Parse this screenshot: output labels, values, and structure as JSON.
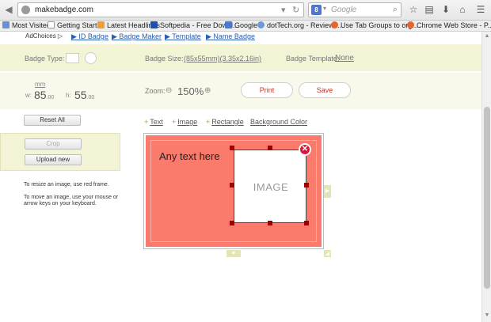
{
  "browser": {
    "url": "makebadge.com",
    "search_placeholder": "Google",
    "search_engine_letter": "8"
  },
  "bookmarks": [
    {
      "label": "Most Visited",
      "color": "#6b8fd6"
    },
    {
      "label": "Getting Started",
      "color": "#ffffff"
    },
    {
      "label": "Latest Headlines",
      "color": "#f0a030"
    },
    {
      "label": "Softpedia - Free Downl...",
      "color": "#1f4fa8"
    },
    {
      "label": "Google",
      "color": "#4b78d0"
    },
    {
      "label": "dotTech.org - Reviews...",
      "color": "#6a9bd8"
    },
    {
      "label": "Use Tab Groups to org...",
      "color": "#e8642a"
    },
    {
      "label": "Chrome Web Store - P...",
      "color": "#e8642a"
    }
  ],
  "ad": {
    "adchoices": "AdChoices",
    "links": [
      "ID Badge",
      "Badge Maker",
      "Template",
      "Name Badge"
    ]
  },
  "settings": {
    "badge_type_label": "Badge Type:",
    "badge_size_label": "Badge Size:",
    "badge_size_value": "(85x55mm)(3.35x2.16in)",
    "badge_template_label": "Badge Template:",
    "badge_template_value": "None"
  },
  "dimensions": {
    "unit": "mm",
    "w_label": "w:",
    "w_value": "85",
    "w_decimal": ".00",
    "h_label": "h:",
    "h_value": "55",
    "h_decimal": ".00"
  },
  "zoom": {
    "label": "Zoom:",
    "value": "150%"
  },
  "actions": {
    "print": "Print",
    "save": "Save",
    "reset": "Reset All",
    "crop": "Crop",
    "upload": "Upload new"
  },
  "help": {
    "resize": "To resize an image, use red frame.",
    "move": "To move an image, use your mouse or arrow keys on your keyboard."
  },
  "tools": {
    "text": "Text",
    "image": "Image",
    "rectangle": "Rectangle",
    "background": "Background Color"
  },
  "badge": {
    "text": "Any text here",
    "image_label": "IMAGE",
    "background_color": "#fa7a6c"
  }
}
